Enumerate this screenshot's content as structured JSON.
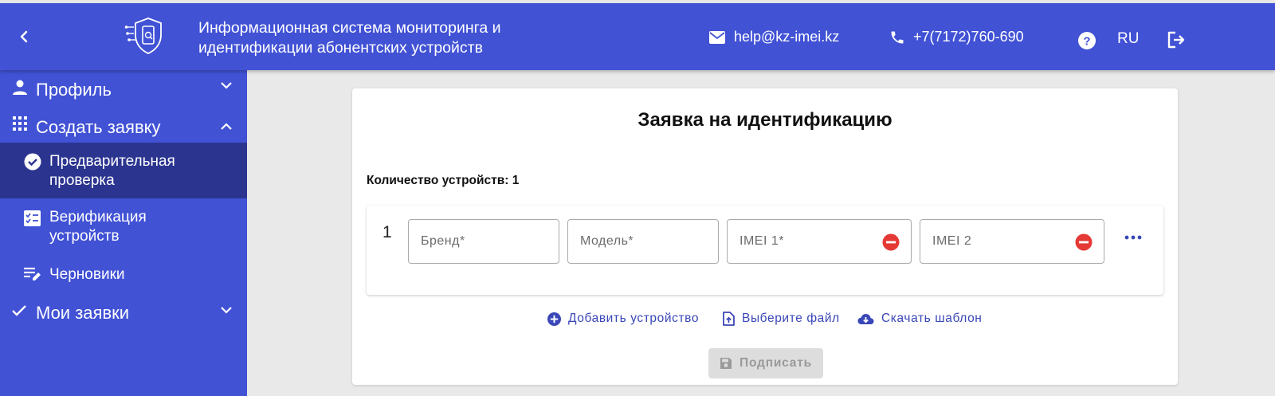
{
  "header": {
    "title_line1": "Информационная система мониторинга и",
    "title_line2": "идентификации абонентских устройств",
    "email": "help@kz-imei.kz",
    "phone": "+7(7172)760-690",
    "language": "RU",
    "icons": [
      "chevron-left-icon",
      "shield-phone-logo",
      "mail-icon",
      "phone-icon",
      "help-icon",
      "logout-icon"
    ]
  },
  "sidebar": {
    "items": [
      {
        "label": "Профиль",
        "icon": "person-icon",
        "expandable": true,
        "expanded": false
      },
      {
        "label": "Создать заявку",
        "icon": "grid-icon",
        "expandable": true,
        "expanded": true
      },
      {
        "label_line1": "Предварительная",
        "label_line2": "проверка",
        "icon": "check-circle-icon",
        "active": true
      },
      {
        "label_line1": "Верификация",
        "label_line2": "устройств",
        "icon": "checklist-icon"
      },
      {
        "label": "Черновики",
        "icon": "edit-list-icon"
      },
      {
        "label": "Мои заявки",
        "icon": "check-icon",
        "expandable": true,
        "expanded": false
      }
    ]
  },
  "main": {
    "heading": "Заявка на идентификацию",
    "device_count": "Количество устройств: 1",
    "rows": [
      {
        "number": "1",
        "brand_placeholder": "Бренд*",
        "model_placeholder": "Модель*",
        "imei1_placeholder": "IMEI 1*",
        "imei2_placeholder": "IMEI 2"
      }
    ],
    "actions": {
      "add_device": "Добавить устройство",
      "choose_file": "Выберите файл",
      "download_template": "Скачать шаблон"
    },
    "sign_button": "Подписать"
  },
  "colors": {
    "primary": "#4152d5",
    "active_nav": "#2b3590",
    "link": "#3a47b8",
    "remove_red": "#e53935",
    "disabled_bg": "#dddddd"
  }
}
